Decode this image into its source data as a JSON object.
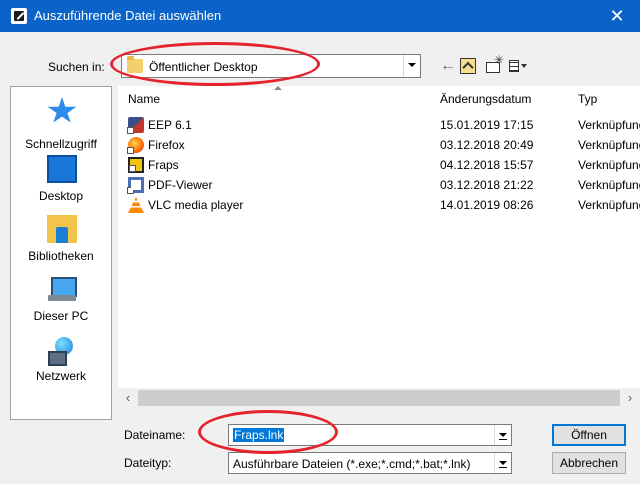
{
  "window": {
    "title": "Auszuführende Datei auswählen",
    "close_glyph": "✕"
  },
  "lookin": {
    "label": "Suchen in:",
    "value": "Öffentlicher Desktop"
  },
  "toolbar": {
    "back_glyph": "←",
    "newfolder_star": "✳"
  },
  "places": [
    {
      "label": "Schnellzugriff",
      "icon": "star-icon"
    },
    {
      "label": "Desktop",
      "icon": "desktop-icon"
    },
    {
      "label": "Bibliotheken",
      "icon": "libraries-icon"
    },
    {
      "label": "Dieser PC",
      "icon": "computer-icon"
    },
    {
      "label": "Netzwerk",
      "icon": "network-icon"
    }
  ],
  "columns": {
    "name": "Name",
    "date": "Änderungsdatum",
    "type": "Typ"
  },
  "files": [
    {
      "name": "EEP 6.1",
      "date": "15.01.2019 17:15",
      "type": "Verknüpfung",
      "icon": "eep-icon"
    },
    {
      "name": "Firefox",
      "date": "03.12.2018 20:49",
      "type": "Verknüpfung",
      "icon": "firefox-icon"
    },
    {
      "name": "Fraps",
      "date": "04.12.2018 15:57",
      "type": "Verknüpfung",
      "icon": "fraps-icon"
    },
    {
      "name": "PDF-Viewer",
      "date": "03.12.2018 21:22",
      "type": "Verknüpfung",
      "icon": "pdf-viewer-icon"
    },
    {
      "name": "VLC media player",
      "date": "14.01.2019 08:26",
      "type": "Verknüpfung",
      "icon": "vlc-icon"
    }
  ],
  "scrollbar": {
    "left_glyph": "‹",
    "right_glyph": "›"
  },
  "filename": {
    "label": "Dateiname:",
    "value": "Fraps.lnk"
  },
  "filetype": {
    "label": "Dateityp:",
    "value": "Ausführbare Dateien (*.exe;*.cmd;*.bat;*.lnk)"
  },
  "buttons": {
    "open": "Öffnen",
    "cancel": "Abbrechen"
  },
  "colors": {
    "titlebar": "#0a63c8",
    "annotation": "#e4232b",
    "selection": "#0078d7"
  }
}
